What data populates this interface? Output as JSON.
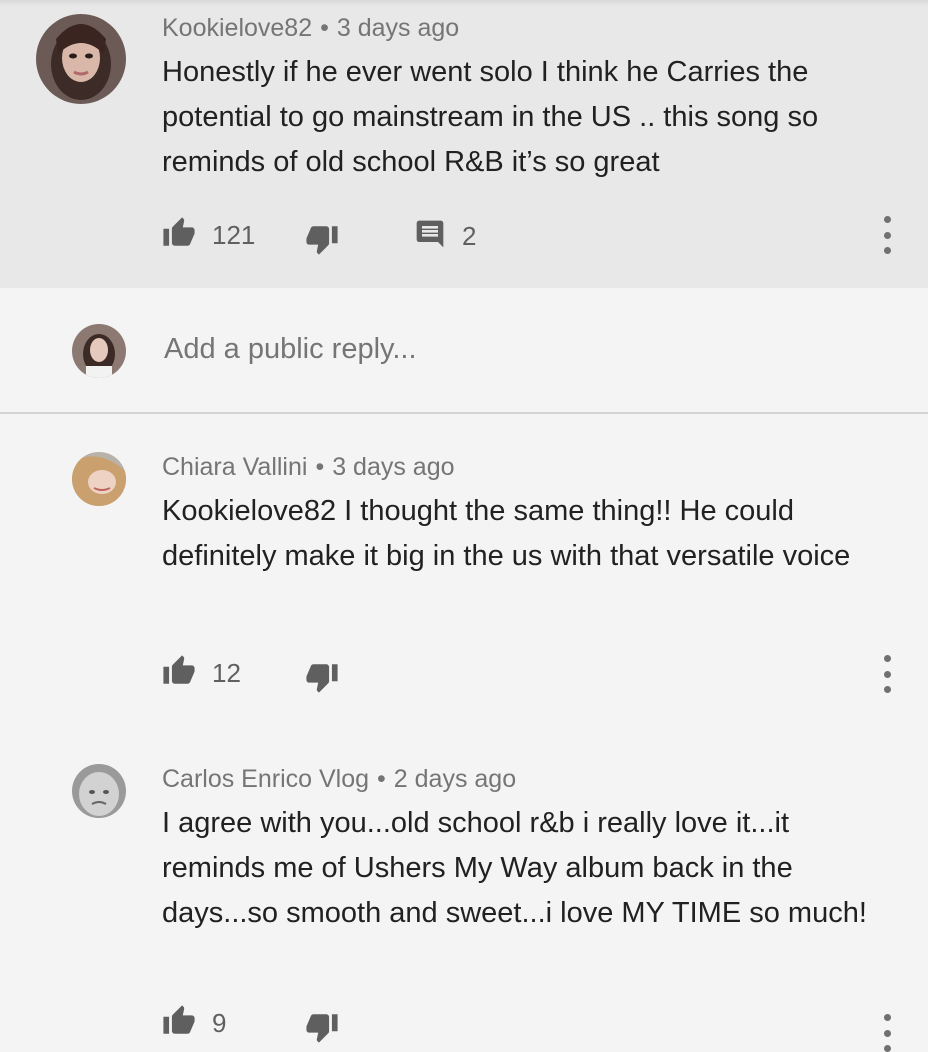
{
  "parent_comment": {
    "author": "Kookielove82",
    "separator": "•",
    "time": "3 days ago",
    "text": "Honestly if he ever went solo I think he Carries the potential to go mainstream in the US .. this song so reminds of old school R&B it’s so great",
    "likes": "121",
    "replies": "2"
  },
  "reply_box": {
    "placeholder": "Add a public reply..."
  },
  "replies": [
    {
      "author": "Chiara Vallini",
      "separator": "•",
      "time": "3 days ago",
      "text": "Kookielove82 I thought the same thing!! He could definitely make it big in the us with that versatile voice",
      "likes": "12"
    },
    {
      "author": "Carlos Enrico Vlog",
      "separator": "•",
      "time": "2 days ago",
      "text": "I agree with you...old school r&b i really love it...it reminds me of Ushers My Way album back in the days...so smooth and sweet...i love MY TIME so much!",
      "likes": "9"
    }
  ],
  "icons": [
    "like-icon",
    "dislike-icon",
    "comment-icon",
    "more-vert-icon"
  ],
  "colors": {
    "parent_bg": "#e8e8e8",
    "page_bg": "#f4f4f4",
    "text": "#212121",
    "meta": "#757575",
    "icon": "#606060"
  }
}
